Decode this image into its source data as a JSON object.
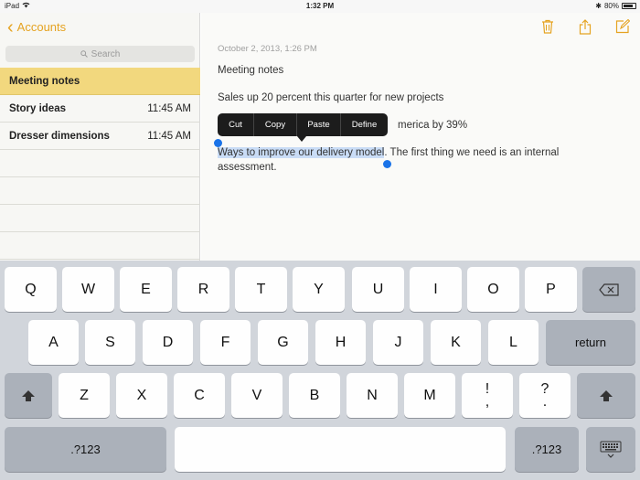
{
  "status_bar": {
    "device": "iPad",
    "time": "1:32 PM",
    "battery": "80%"
  },
  "sidebar": {
    "back_label": "Accounts",
    "search_placeholder": "Search",
    "notes": [
      {
        "title": "Meeting notes",
        "time": ""
      },
      {
        "title": "Story ideas",
        "time": "11:45 AM"
      },
      {
        "title": "Dresser dimensions",
        "time": "11:45 AM"
      }
    ]
  },
  "note": {
    "date": "October 2, 2013, 1:26 PM",
    "line1": "Meeting notes",
    "line2": "Sales up 20 percent this quarter for new projects",
    "line3_visible": "merica by 39%",
    "selected_text": "Ways to improve our delivery model",
    "after_selection": ". The first thing we need is an internal",
    "line5": "assessment."
  },
  "edit_menu": {
    "items": [
      "Cut",
      "Copy",
      "Paste",
      "Define"
    ]
  },
  "keyboard": {
    "row1": [
      "Q",
      "W",
      "E",
      "R",
      "T",
      "Y",
      "U",
      "I",
      "O",
      "P"
    ],
    "row2": [
      "A",
      "S",
      "D",
      "F",
      "G",
      "H",
      "J",
      "K",
      "L"
    ],
    "row3": [
      "Z",
      "X",
      "C",
      "V",
      "B",
      "N",
      "M",
      "!\n,",
      "?\n."
    ],
    "return_label": "return",
    "numbers_label": ".?123"
  },
  "colors": {
    "accent": "#e5a321",
    "selection": "#c9dcf6",
    "selected_row": "#f2d87e"
  }
}
